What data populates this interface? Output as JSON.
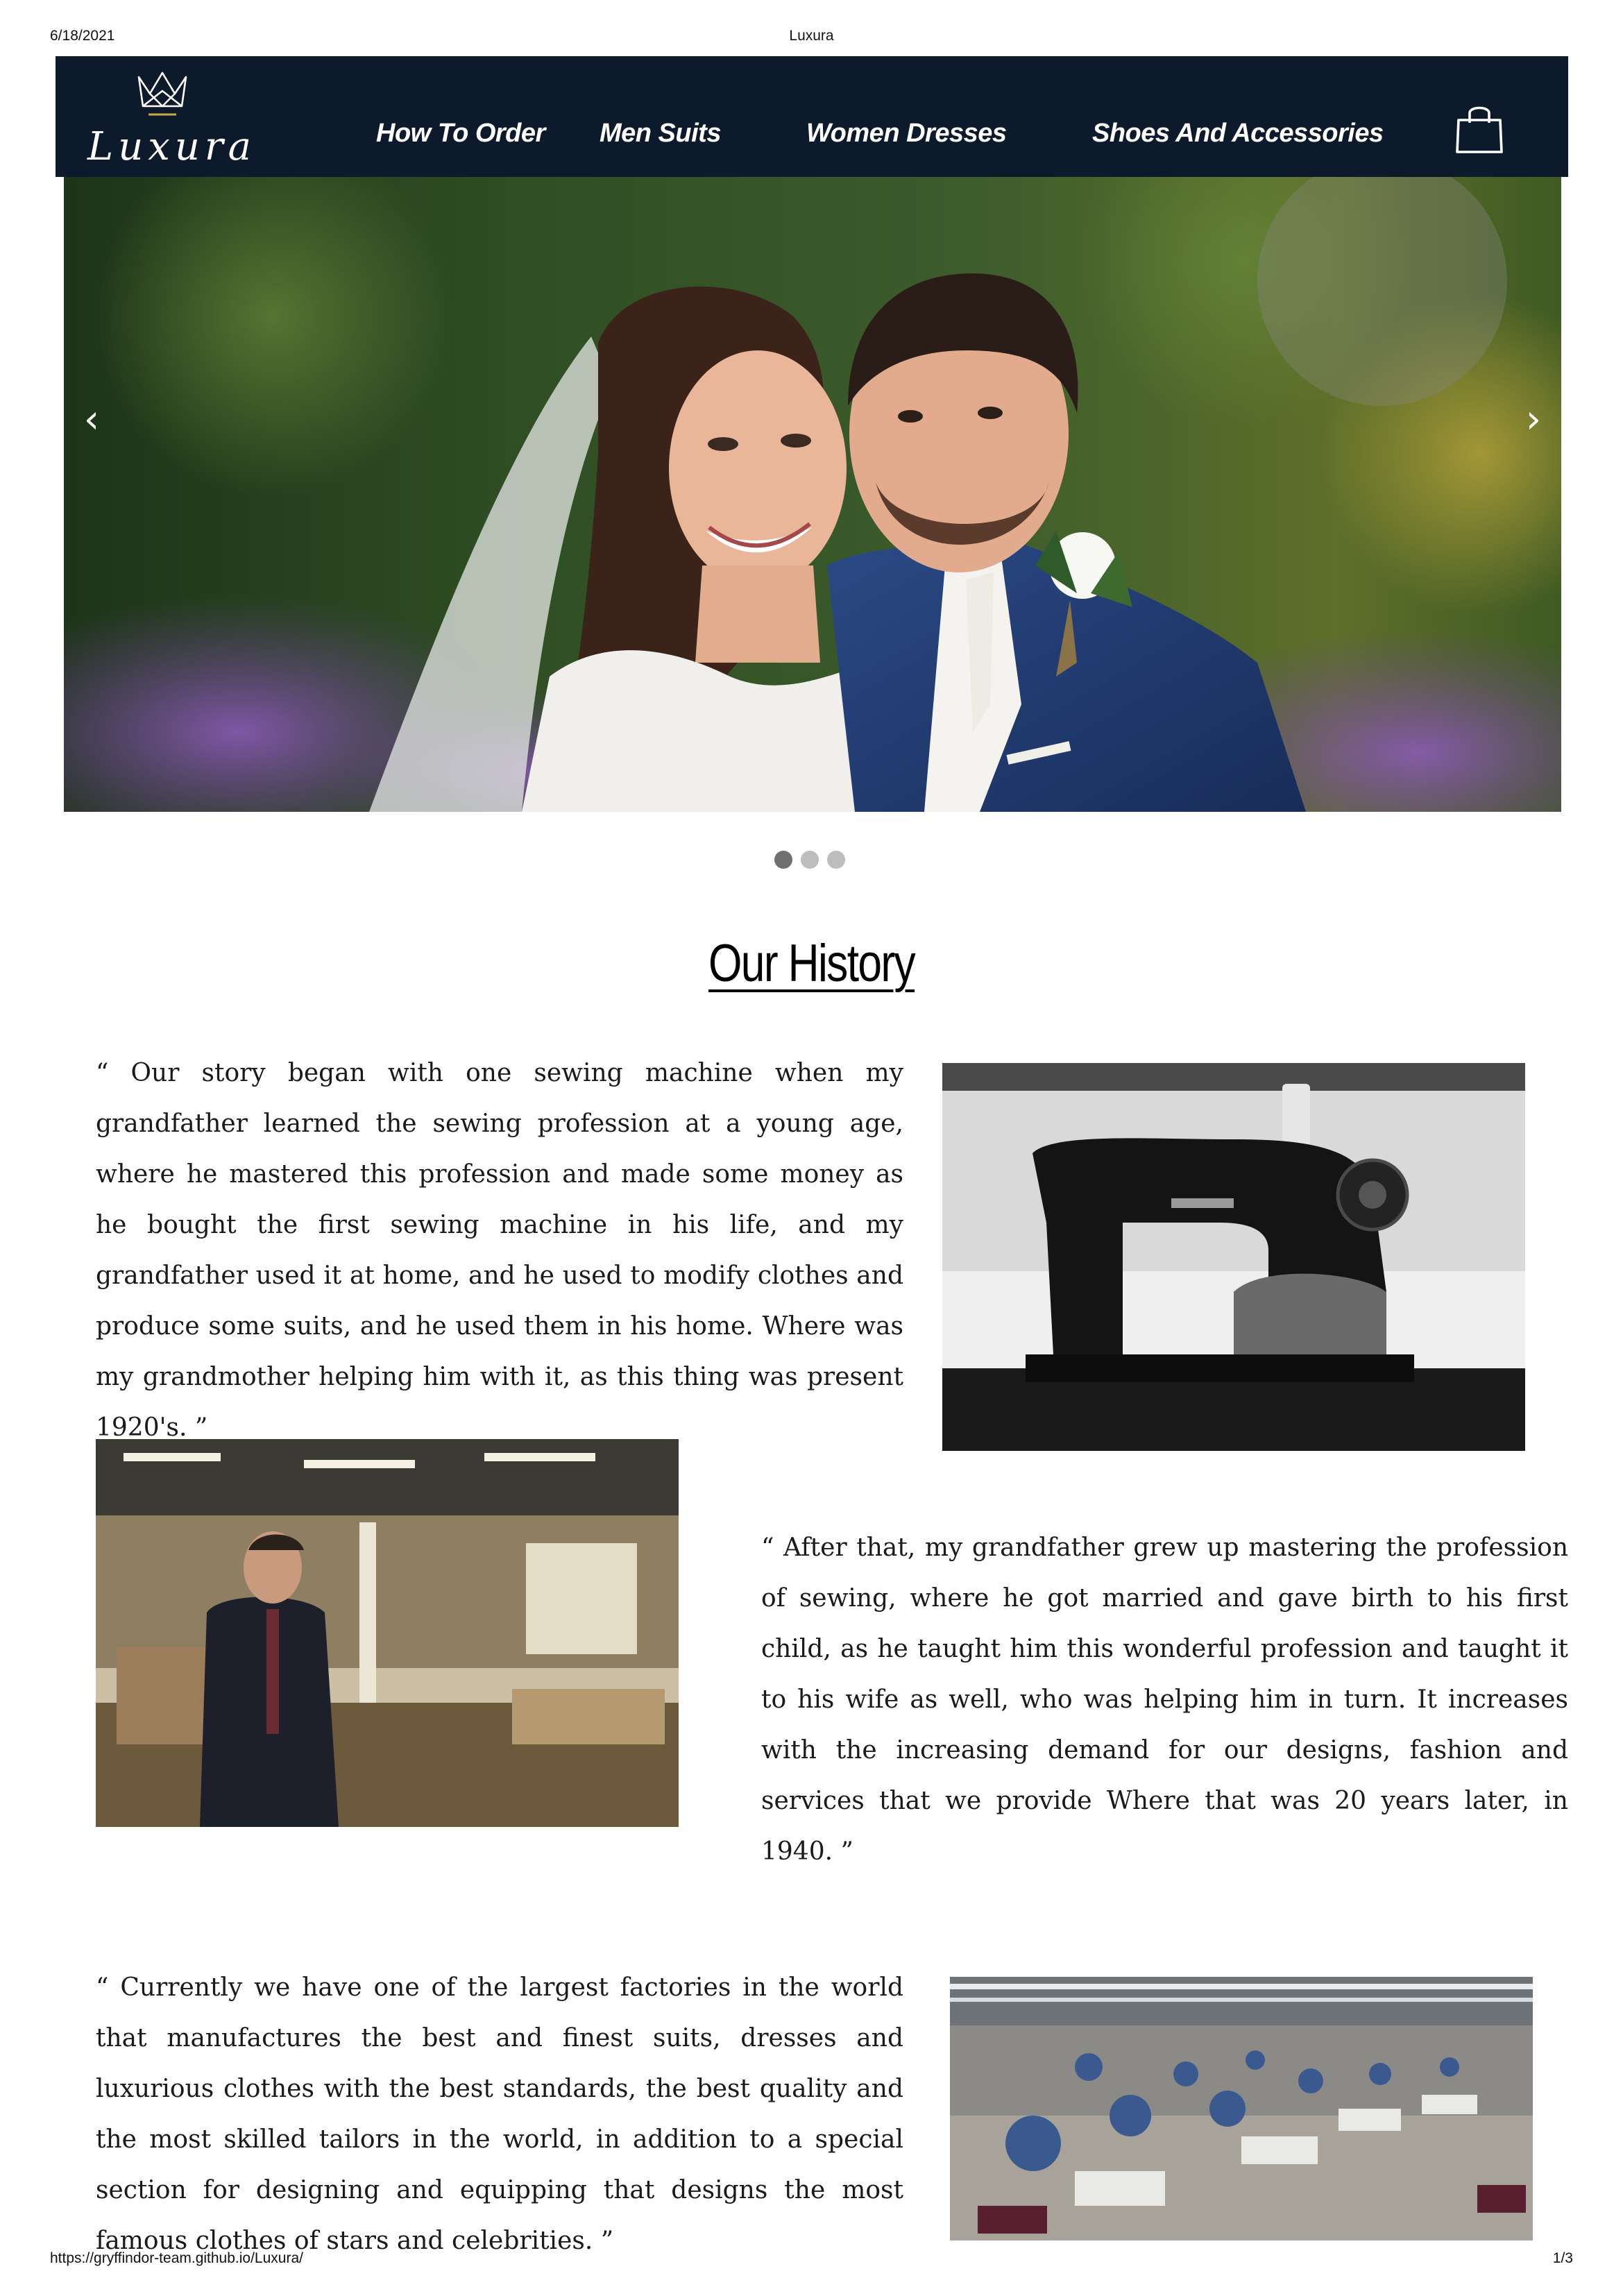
{
  "print_header": {
    "date": "6/18/2021",
    "title": "Luxura"
  },
  "print_footer": {
    "url": "https://gryffindor-team.github.io/Luxura/",
    "page": "1/3"
  },
  "navbar": {
    "brand": "Luxura",
    "links": [
      "How To Order",
      "Men Suits",
      "Women Dresses",
      "Shoes And Accessories"
    ],
    "cart_icon": "shopping-bag-icon",
    "background": "#0c1a2b"
  },
  "carousel": {
    "prev_glyph": "‹",
    "next_glyph": "›",
    "slide_count": 3,
    "active_slide": 1,
    "image": "wedding-couple-photo"
  },
  "history": {
    "title": "Our History",
    "paragraphs": [
      "“ Our story began with one sewing machine when my grandfather learned the sewing profession at a young age, where he mastered this profession and made some money as he bought the first sewing machine in his life, and my grandfather used it at home, and he used to modify clothes and produce some suits, and he used them in his home. Where was my grandmother helping him with it, as this thing was present 1920's. ”",
      "“ After that, my grandfather grew up mastering the profession of sewing, where he got married and gave birth to his first child, as he taught him this wonderful profession and taught it to his wife as well, who was helping him in turn. It increases with the increasing demand for our designs, fashion and services that we provide Where that was 20 years later, in 1940. ”",
      "“ Currently we have one of the largest factories in the world that manufactures the best and finest suits, dresses and luxurious clothes with the best standards, the best quality and the most skilled tailors in the world, in addition to a special section for designing and equipping that designs the most famous clothes of stars and celebrities. ”"
    ],
    "images": [
      "sewing-machine-photo",
      "tailor-workshop-photo",
      "garment-factory-photo"
    ]
  }
}
